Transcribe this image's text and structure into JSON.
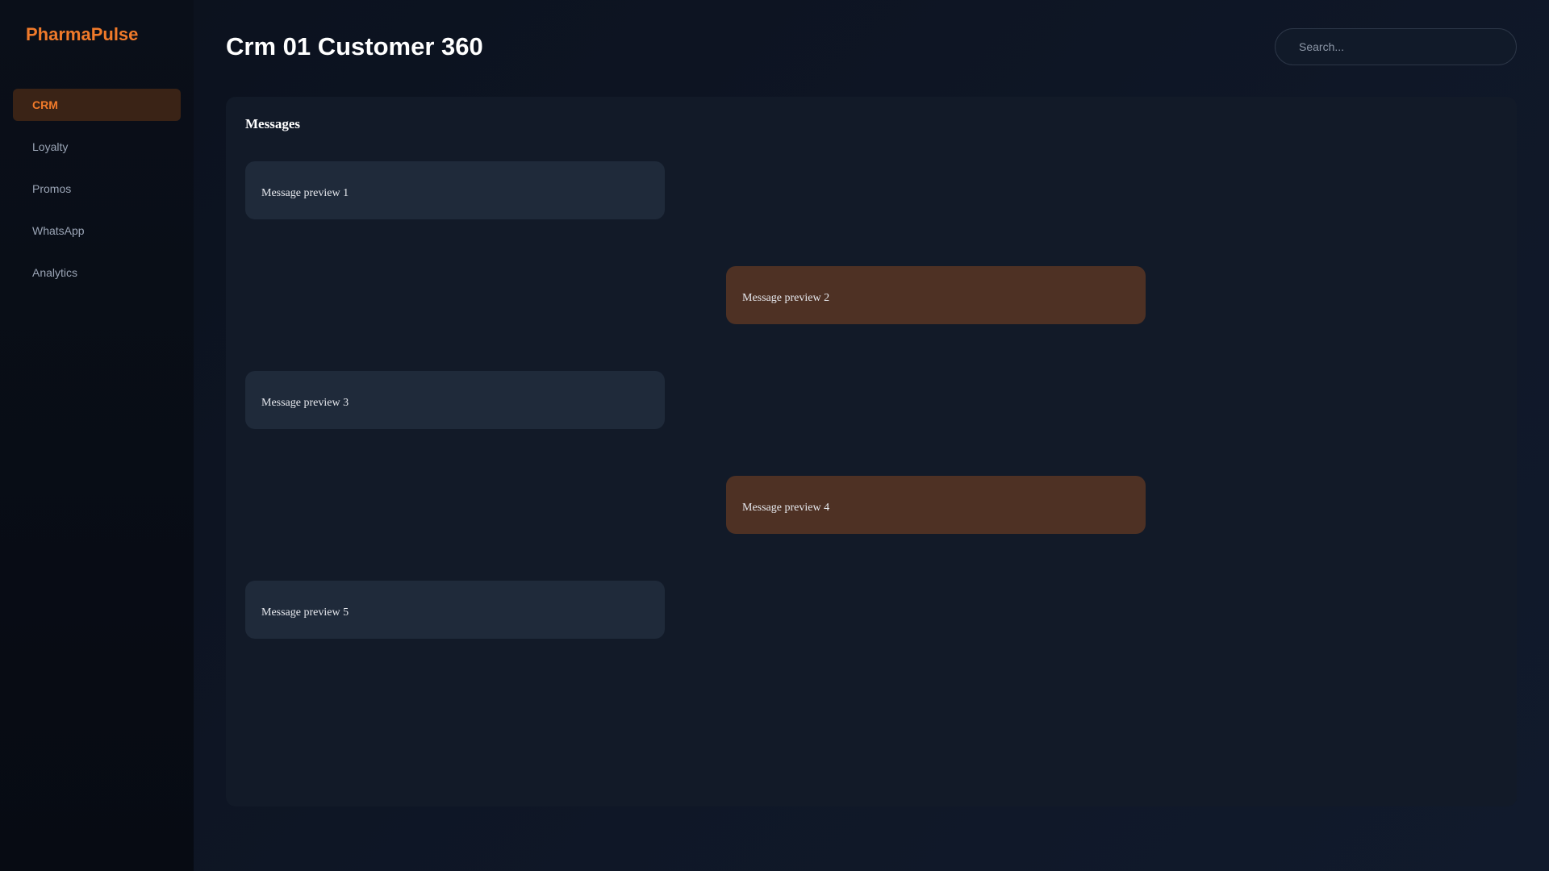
{
  "app": {
    "brand": "PharmaPulse"
  },
  "sidebar": {
    "items": [
      {
        "label": "CRM",
        "active": true
      },
      {
        "label": "Loyalty",
        "active": false
      },
      {
        "label": "Promos",
        "active": false
      },
      {
        "label": "WhatsApp",
        "active": false
      },
      {
        "label": "Analytics",
        "active": false
      }
    ]
  },
  "header": {
    "title": "Crm 01 Customer 360",
    "search_placeholder": "Search..."
  },
  "messages": {
    "title": "Messages",
    "items": [
      {
        "text": "Message preview 1",
        "direction": "incoming"
      },
      {
        "text": "Message preview 2",
        "direction": "outgoing"
      },
      {
        "text": "Message preview 3",
        "direction": "incoming"
      },
      {
        "text": "Message preview 4",
        "direction": "outgoing"
      },
      {
        "text": "Message preview 5",
        "direction": "incoming"
      }
    ]
  },
  "colors": {
    "accent": "#f07a2a",
    "active_nav_bg": "#3a2316",
    "incoming_bubble": "#1f2a3a",
    "outgoing_bubble": "#4e3124"
  }
}
